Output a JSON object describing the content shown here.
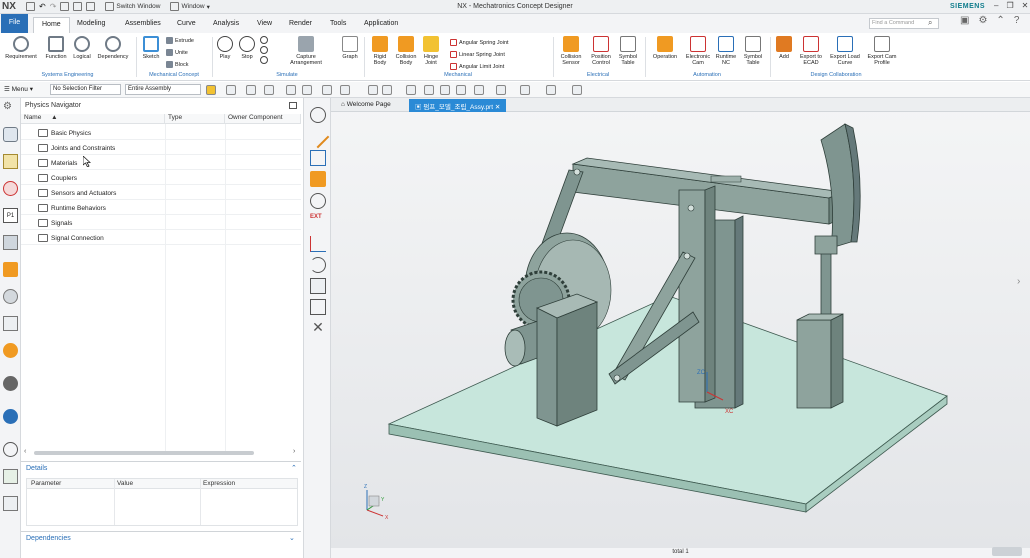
{
  "titlebar": {
    "logo": "NX",
    "switch_window": "Switch Window",
    "window_menu": "Window",
    "app_title": "NX - Mechatronics Concept Designer",
    "brand": "SIEMENS"
  },
  "menu": {
    "file": "File",
    "tabs": [
      "Home",
      "Modeling",
      "Assemblies",
      "Curve",
      "Analysis",
      "View",
      "Render",
      "Tools",
      "Application"
    ],
    "find_placeholder": "Find a Command"
  },
  "ribbon": {
    "systems_engineering": {
      "label": "Systems Engineering",
      "buttons": [
        "Requirement",
        "Function",
        "Logical",
        "Dependency"
      ]
    },
    "mechanical_concept": {
      "label": "Mechanical Concept",
      "sketch": "Sketch",
      "small": [
        "Extrude",
        "Unite",
        "Block"
      ]
    },
    "simulate": {
      "label": "Simulate",
      "buttons": [
        "Play",
        "Stop",
        "Capture Arrangement",
        "Graph"
      ]
    },
    "mechanical": {
      "label": "Mechanical",
      "buttons": [
        "Rigid Body",
        "Collision Body",
        "Hinge Joint"
      ],
      "small": [
        "Angular Spring Joint",
        "Linear Spring Joint",
        "Angular Limit Joint"
      ]
    },
    "electrical": {
      "label": "Electrical",
      "buttons": [
        "Collision Sensor",
        "Position Control",
        "Symbol Table"
      ]
    },
    "automation": {
      "label": "Automation",
      "buttons": [
        "Operation",
        "Electronic Cam",
        "Runtime NC",
        "Symbol Table"
      ]
    },
    "design_collaboration": {
      "label": "Design Collaboration",
      "buttons": [
        "Add",
        "Export to ECAD",
        "Export Load Curve",
        "Export Cam Profile"
      ]
    }
  },
  "toolbar2": {
    "menu": "Menu",
    "selection_filter": "No Selection Filter",
    "scope": "Entire Assembly"
  },
  "navigator": {
    "title": "Physics Navigator",
    "columns": [
      "Name",
      "Type",
      "Owner Component"
    ],
    "items": [
      "Basic Physics",
      "Joints and Constraints",
      "Materials",
      "Couplers",
      "Sensors and Actuators",
      "Runtime Behaviors",
      "Signals",
      "Signal Connection"
    ],
    "details_title": "Details",
    "details_columns": [
      "Parameter",
      "Value",
      "Expression"
    ],
    "dependencies": "Dependencies"
  },
  "viewport": {
    "tabs": [
      "Welcome Page",
      "펌프_모델_조립_Assy.prt"
    ],
    "axis_labels": {
      "zc": "ZC",
      "xc": "XC",
      "z": "Z",
      "x": "X",
      "y": "Y"
    }
  },
  "status": "total 1",
  "colors": {
    "accent": "#2a6fb7",
    "model": "#7e958a",
    "plate": "#c7e6dc"
  }
}
